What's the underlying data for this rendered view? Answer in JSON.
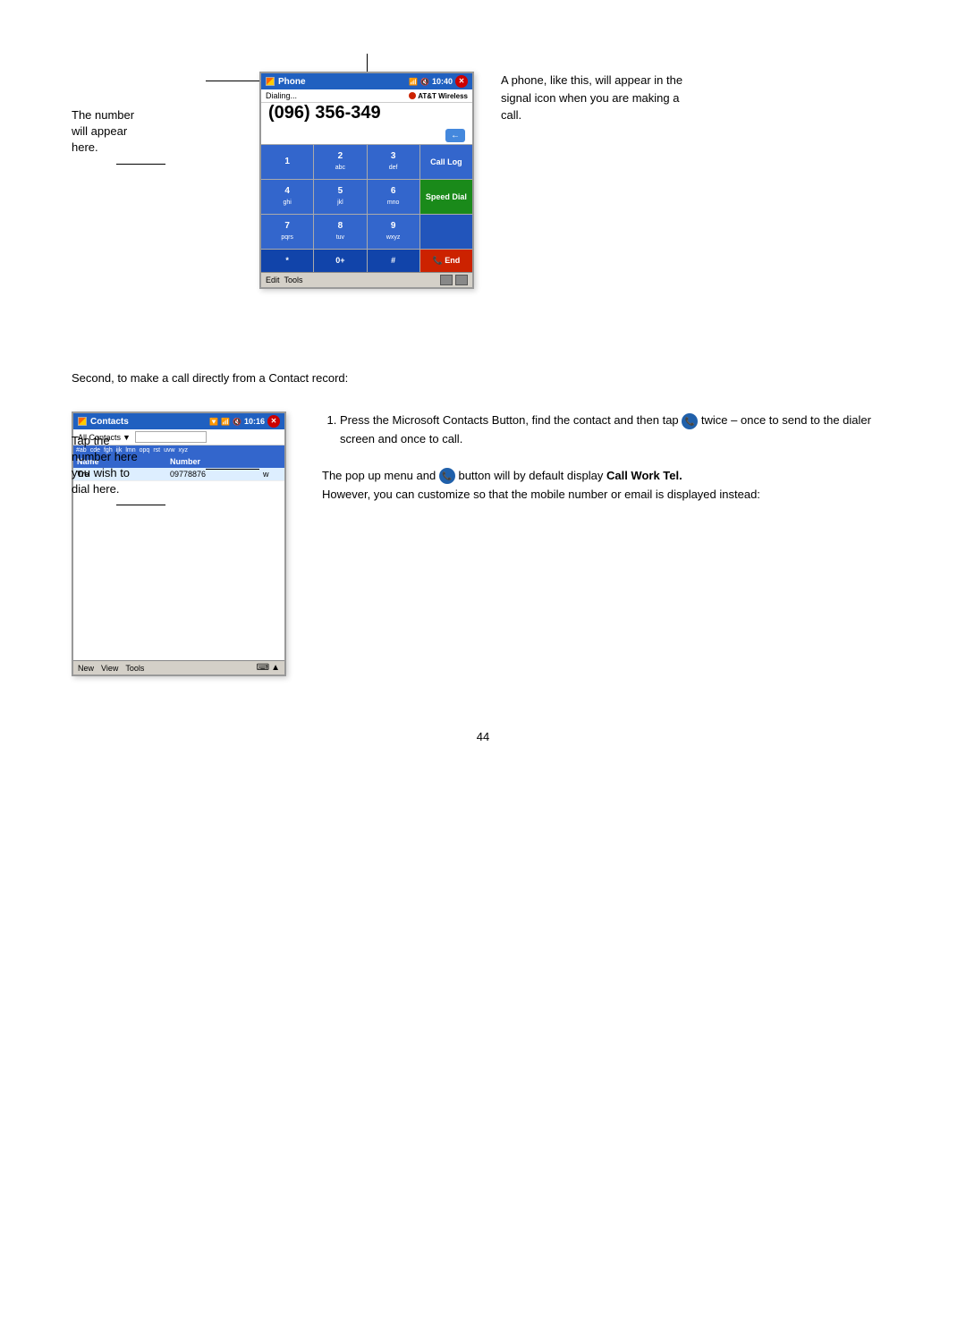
{
  "page": {
    "number": "44"
  },
  "top_diagram": {
    "left_label_1": "The number\nwill appear\nhere.",
    "left_label_2": "Tap the\nnumber here\nyou wish to\ndial here.",
    "right_annotation": "A phone, like this, will appear in the signal icon when you are making a call.",
    "phone": {
      "title": "Phone",
      "time": "10:40",
      "status": "Dialing...",
      "carrier": "AT&T Wireless",
      "number": "(096) 356-349",
      "keys": [
        {
          "label": "1",
          "sub": "",
          "type": "normal"
        },
        {
          "label": "2",
          "sub": "abc",
          "type": "normal"
        },
        {
          "label": "3",
          "sub": "def",
          "type": "normal"
        },
        {
          "label": "Call Log",
          "sub": "",
          "type": "call-log"
        },
        {
          "label": "4",
          "sub": "ghi",
          "type": "normal"
        },
        {
          "label": "5",
          "sub": "jkl",
          "type": "normal"
        },
        {
          "label": "6",
          "sub": "mno",
          "type": "normal"
        },
        {
          "label": "Speed Dial",
          "sub": "",
          "type": "speed-dial"
        },
        {
          "label": "7",
          "sub": "pqrs",
          "type": "normal"
        },
        {
          "label": "8",
          "sub": "tuv",
          "type": "normal"
        },
        {
          "label": "9",
          "sub": "wxyz",
          "type": "normal"
        },
        {
          "label": "",
          "sub": "",
          "type": "empty"
        },
        {
          "label": "*",
          "sub": "",
          "type": "special"
        },
        {
          "label": "0+",
          "sub": "",
          "type": "special"
        },
        {
          "label": "#",
          "sub": "",
          "type": "special"
        },
        {
          "label": "End",
          "sub": "",
          "type": "end-call"
        }
      ],
      "toolbar": {
        "edit": "Edit",
        "tools": "Tools"
      }
    }
  },
  "middle_text": "Second, to make a call directly from a Contact record:",
  "bottom_diagram": {
    "contacts": {
      "title": "Contacts",
      "time": "10:16",
      "filter": "All Contacts",
      "alphabet": [
        "#ab",
        "cde",
        "fgh",
        "ijk",
        "lmn",
        "opq",
        "rst",
        "uvw",
        "xyz"
      ],
      "selected_alpha": "Tre",
      "list_header": [
        "Name",
        "Number",
        ""
      ],
      "list_row": {
        "name": "Tre",
        "number": "09778876",
        "flag": "w"
      },
      "toolbar": {
        "new": "New",
        "view": "View",
        "tools": "Tools"
      }
    },
    "instructions": [
      {
        "number": 1,
        "text": "Press the Microsoft Contacts Button, find the contact and then tap",
        "text2": "twice – once to send to the dialer screen and once to call."
      }
    ],
    "popup_text": "The pop up menu and",
    "popup_text2": "button will by default display",
    "popup_bold": "Call Work Tel.",
    "popup_text3": "However, you can customize so that the mobile number or email is displayed instead:"
  }
}
